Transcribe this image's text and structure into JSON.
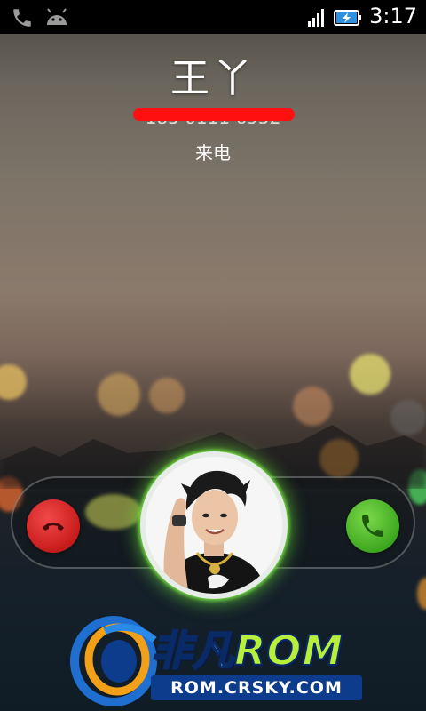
{
  "status_bar": {
    "time": "3:17",
    "icons": [
      "phone-icon",
      "android-icon",
      "signal-icon",
      "battery-charging-icon"
    ]
  },
  "caller": {
    "name": "王丫",
    "number": "185 0111 6952",
    "state": "来电"
  },
  "actions": {
    "decline_icon": "hang-up-icon",
    "accept_icon": "phone-answer-icon",
    "decline_color": "#d42424",
    "accept_color": "#4cb82a"
  },
  "watermark": {
    "title_left": "非凡",
    "title_right": "ROM",
    "url": "ROM.CRSKY.COM"
  }
}
